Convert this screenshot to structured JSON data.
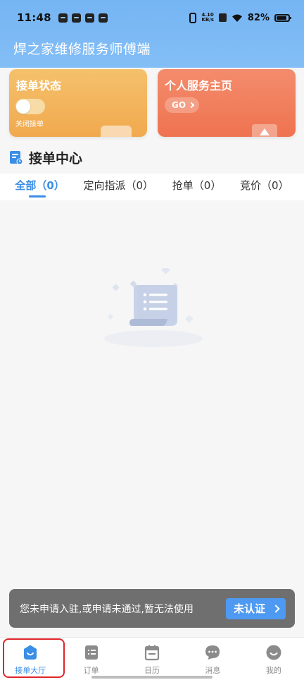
{
  "status_bar": {
    "time": "11:48",
    "net_speed_value": "4.10",
    "net_speed_unit": "KB/s",
    "battery": "82%"
  },
  "header": {
    "title": "焊之家维修服务师傅端"
  },
  "cards": {
    "order_status": {
      "title": "接单状态",
      "switch_label": "关闭接单",
      "switch_on": false
    },
    "homepage": {
      "title": "个人服务主页",
      "go_label": "GO"
    }
  },
  "section": {
    "title": "接单中心"
  },
  "tabs": [
    {
      "label": "全部（0）",
      "active": true
    },
    {
      "label": "定向指派（0）",
      "active": false
    },
    {
      "label": "抢单（0）",
      "active": false
    },
    {
      "label": "竞价（0）",
      "active": false
    }
  ],
  "notice": {
    "text": "您未申请入驻,或申请未通过,暂无法使用",
    "button_label": "未认证"
  },
  "bottom_nav": [
    {
      "label": "接单大厅",
      "icon": "hall-icon",
      "active": true
    },
    {
      "label": "订单",
      "icon": "order-icon",
      "active": false
    },
    {
      "label": "日历",
      "icon": "calendar-icon",
      "active": false
    },
    {
      "label": "消息",
      "icon": "message-icon",
      "active": false
    },
    {
      "label": "我的",
      "icon": "profile-icon",
      "active": false
    }
  ],
  "colors": {
    "header_blue": "#7ab8f5",
    "accent_blue": "#3a8ee6",
    "card_orange": "#f1a94f",
    "card_red": "#ef7350",
    "notice_bg": "#6f6f6f",
    "highlight_red": "#e0242a"
  }
}
